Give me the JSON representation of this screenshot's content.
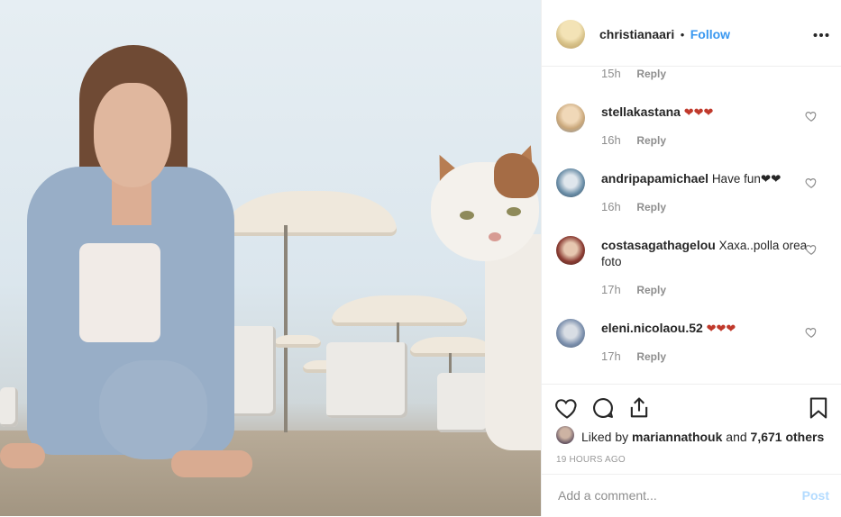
{
  "header": {
    "username": "christianaari",
    "separator": "•",
    "follow_label": "Follow",
    "more_icon": "more-icon"
  },
  "top_meta": {
    "time": "15h",
    "reply_label": "Reply"
  },
  "comments": [
    {
      "username": "stellakastana",
      "text": "❤❤❤",
      "time": "16h",
      "reply_label": "Reply"
    },
    {
      "username": "andripapamichael",
      "text": "Have fun❤❤",
      "time": "16h",
      "reply_label": "Reply"
    },
    {
      "username": "costasagathagelou",
      "text": "Xaxa..polla orea foto",
      "time": "17h",
      "reply_label": "Reply"
    },
    {
      "username": "eleni.nicolaou.52",
      "text": "❤❤❤",
      "time": "17h",
      "reply_label": "Reply"
    }
  ],
  "actions": {
    "like_icon": "heart-icon",
    "comment_icon": "comment-icon",
    "share_icon": "share-icon",
    "save_icon": "bookmark-icon"
  },
  "likes": {
    "prefix": "Liked by",
    "user": "mariannathouk",
    "conj": "and",
    "others": "7,671 others"
  },
  "timestamp": "19 HOURS AGO",
  "add_comment": {
    "placeholder": "Add a comment...",
    "post_label": "Post"
  },
  "colors": {
    "link": "#3897f0",
    "post_disabled": "#b3dbff",
    "meta": "#8e8e8e"
  }
}
